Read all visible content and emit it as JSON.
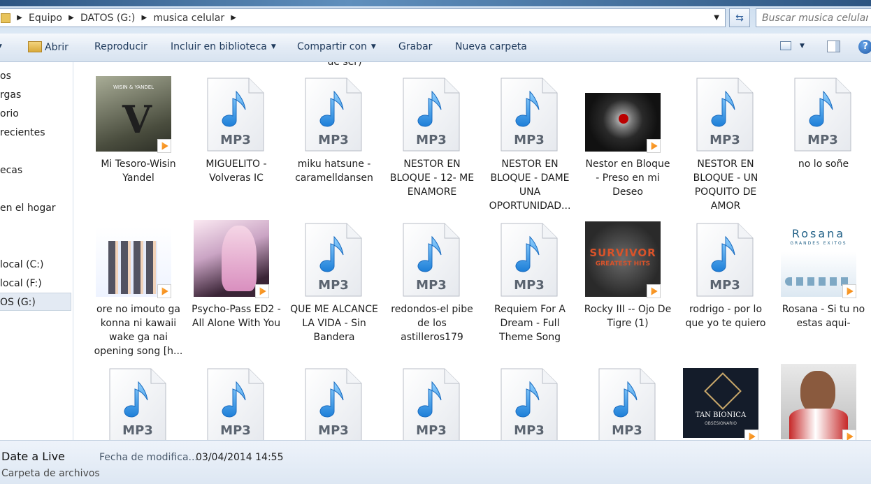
{
  "address": {
    "crumbs": [
      "Equipo",
      "DATOS (G:)",
      "musica celular"
    ],
    "search_placeholder": "Buscar musica celular"
  },
  "toolbar": {
    "open": "Abrir",
    "play": "Reproducir",
    "include": "Incluir en biblioteca",
    "share": "Compartir con",
    "burn": "Grabar",
    "new_folder": "Nueva carpeta"
  },
  "nav": {
    "items": [
      "os",
      "rgas",
      "orio",
      "recientes",
      "ecas",
      "en el hogar",
      "local (C:)",
      "local (F:)",
      "OS (G:)"
    ]
  },
  "cut_label": "de ser)",
  "files": [
    {
      "name": "Mi Tesoro-Wisin Yandel",
      "type": "art"
    },
    {
      "name": "MIGUELITO - Volveras     IC",
      "type": "mp3"
    },
    {
      "name": "miku hatsune - caramelldansen",
      "type": "mp3"
    },
    {
      "name": "NESTOR EN BLOQUE - 12- ME ENAMORE",
      "type": "mp3"
    },
    {
      "name": "NESTOR EN BLOQUE - DAME UNA OPORTUNIDAD...",
      "type": "mp3"
    },
    {
      "name": "Nestor en Bloque - Preso en mi Deseo",
      "type": "art"
    },
    {
      "name": "NESTOR EN BLOQUE - UN POQUITO DE AMOR",
      "type": "mp3"
    },
    {
      "name": "no lo soñe",
      "type": "mp3"
    },
    {
      "name": "ore no imouto ga konna ni kawaii wake ga nai opening song [h...",
      "type": "art"
    },
    {
      "name": "Psycho-Pass ED2 - All Alone With You",
      "type": "art"
    },
    {
      "name": "QUE ME ALCANCE LA VIDA - Sin Bandera",
      "type": "mp3"
    },
    {
      "name": "redondos-el pibe de los astilleros179",
      "type": "mp3"
    },
    {
      "name": "Requiem For A Dream - Full Theme Song",
      "type": "mp3"
    },
    {
      "name": "Rocky III -- Ojo De Tigre (1)",
      "type": "art"
    },
    {
      "name": "rodrigo - por lo que yo te quiero",
      "type": "mp3"
    },
    {
      "name": "Rosana - Si tu no estas aqui-",
      "type": "art"
    },
    {
      "name": "",
      "type": "mp3"
    },
    {
      "name": "",
      "type": "mp3"
    },
    {
      "name": "",
      "type": "mp3"
    },
    {
      "name": "",
      "type": "mp3"
    },
    {
      "name": "",
      "type": "mp3"
    },
    {
      "name": "",
      "type": "mp3"
    },
    {
      "name": "",
      "type": "art"
    },
    {
      "name": "",
      "type": "art"
    }
  ],
  "mp3_badge": "MP3",
  "art_text": {
    "wisin": "WISIN & YANDEL",
    "survivor1": "SURVIVOR",
    "survivor2": "GREATEST HITS",
    "rosana1": "Rosana",
    "rosana2": "GRANDES EXITOS",
    "tan1": "TAN BIONICA",
    "tan2": "OBSESIONARIO"
  },
  "details": {
    "name": "Date a Live",
    "type": "Carpeta de archivos",
    "modified_label": "Fecha de modifica...",
    "modified_value": "03/04/2014 14:55"
  },
  "colors": {
    "accent": "#3a8fe0",
    "toolbar_text": "#1e395b"
  }
}
